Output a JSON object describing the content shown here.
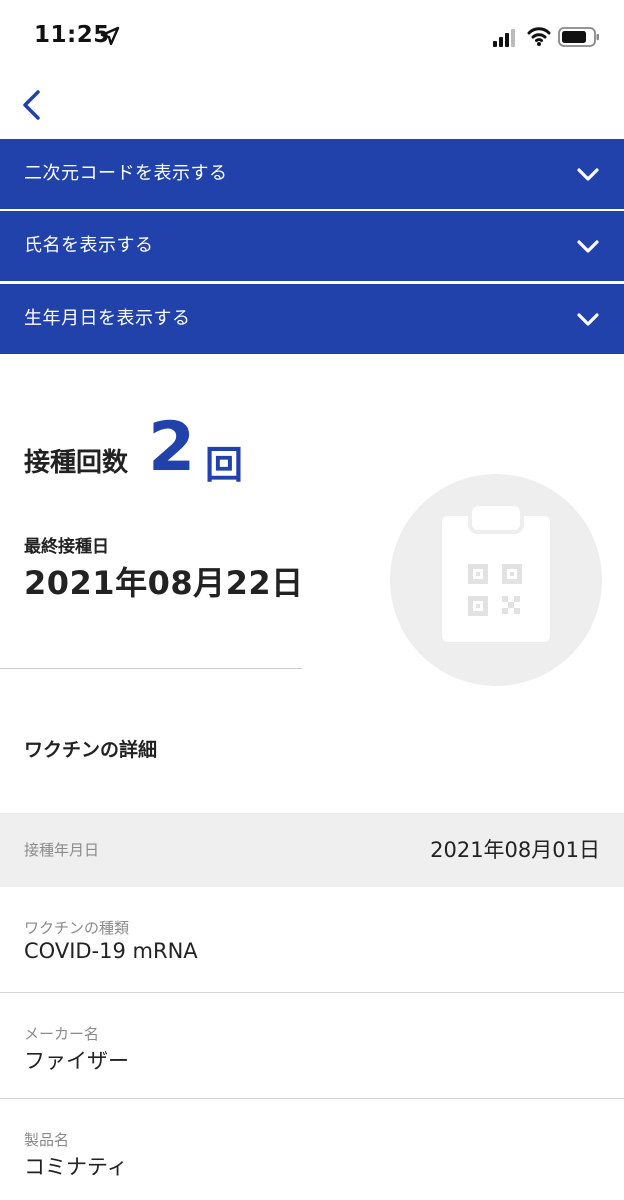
{
  "status_bar": {
    "time": "11:25",
    "icons": [
      "location-arrow-icon",
      "signal-icon",
      "wifi-icon",
      "battery-icon"
    ]
  },
  "nav": {
    "back_icon": "chevron-left-icon"
  },
  "accordions": [
    {
      "label": "二次元コードを表示する",
      "icon": "chevron-down-icon"
    },
    {
      "label": "氏名を表示する",
      "icon": "chevron-down-icon"
    },
    {
      "label": "生年月日を表示する",
      "icon": "chevron-down-icon"
    }
  ],
  "summary": {
    "dose_label": "接種回数",
    "dose_count": "2",
    "dose_unit": "回",
    "last_date_label": "最終接種日",
    "last_date_value": "2021年08月22日",
    "badge_icon": "clipboard-qr-icon"
  },
  "details": {
    "section_title": "ワクチンの詳細",
    "date_row": {
      "label": "接種年月日",
      "value": "2021年08月01日"
    },
    "items": [
      {
        "label": "ワクチンの種類",
        "value": "COVID-19 mRNA"
      },
      {
        "label": "メーカー名",
        "value": "ファイザー"
      },
      {
        "label": "製品名",
        "value": "コミナティ"
      }
    ]
  },
  "colors": {
    "accent": "#2142ab",
    "row_bg": "#efefef",
    "badge_bg": "#eeeeee",
    "muted_text": "#8a8a8a"
  }
}
